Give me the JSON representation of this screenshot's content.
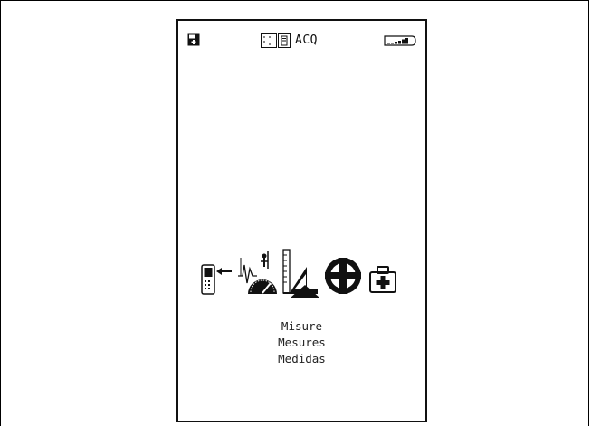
{
  "status_bar": {
    "mode_label": "ACQ",
    "icons": [
      "floppy-disk-icon",
      "acquisition-mode-icon",
      "battery-icon"
    ]
  },
  "menu": {
    "icons": [
      "device-transfer-icon",
      "meter-measure-icon",
      "ruler-setsquare-icon",
      "crosshair-circle-icon",
      "first-aid-kit-icon"
    ],
    "selected_index": 1,
    "selected_labels": [
      "Misure",
      "Mesures",
      "Medidas"
    ]
  }
}
